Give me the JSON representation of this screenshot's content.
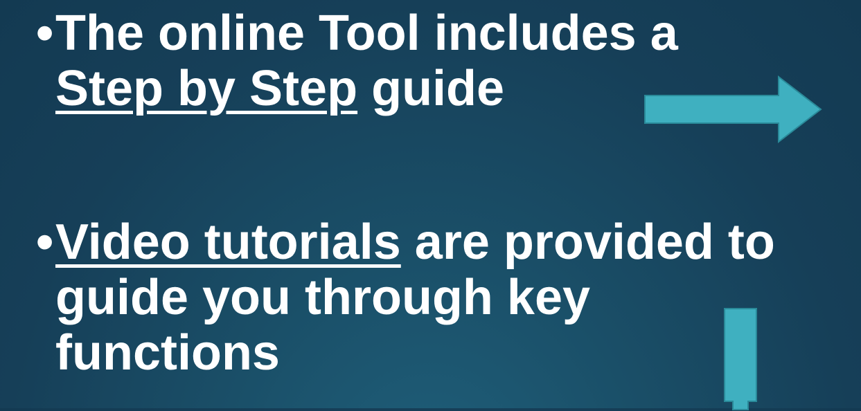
{
  "bullets": [
    {
      "lines": [
        {
          "plain": "The online Tool includes a"
        },
        {
          "link": "Step by Step",
          "after": " guide"
        }
      ]
    },
    {
      "lines": [
        {
          "link": "Video tutorials",
          "after": " are provided to"
        },
        {
          "plain": "guide you through key"
        },
        {
          "plain": "functions"
        }
      ]
    }
  ],
  "bullet_symbol": "•",
  "colors": {
    "background": "#163f58",
    "text": "#ffffff",
    "arrow_fill": "#3fb0c0",
    "arrow_stroke": "#2a8a99"
  },
  "icons": {
    "right_arrow": "arrow-right-icon",
    "down_arrow": "arrow-down-icon"
  }
}
